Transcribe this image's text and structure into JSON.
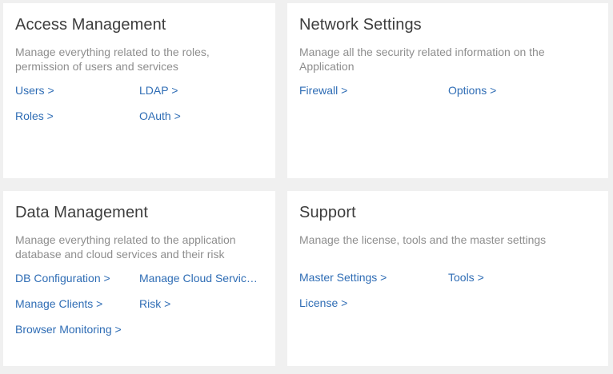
{
  "cards": {
    "access": {
      "title": "Access Management",
      "description": "Manage everything related to the roles, permission of users and services",
      "links": [
        "Users >",
        "LDAP >",
        "Roles >",
        "OAuth >"
      ]
    },
    "network": {
      "title": "Network Settings",
      "description": "Manage all the security related information on the Application",
      "links": [
        "Firewall >",
        "Options >"
      ]
    },
    "data": {
      "title": "Data Management",
      "description": "Manage everything related to the application database and cloud services and their risk",
      "links": [
        "DB Configuration >",
        "Manage Cloud Services >",
        "Manage Clients >",
        "Risk >",
        "Browser Monitoring >"
      ]
    },
    "support": {
      "title": "Support",
      "description": "Manage the license, tools and the master settings",
      "links": [
        "Master Settings >",
        "Tools >",
        "License >"
      ]
    }
  },
  "colors": {
    "background": "#f0f0f0",
    "card": "#ffffff",
    "title": "#3d3d3d",
    "description": "#8e8e8e",
    "link": "#2f6db5"
  }
}
